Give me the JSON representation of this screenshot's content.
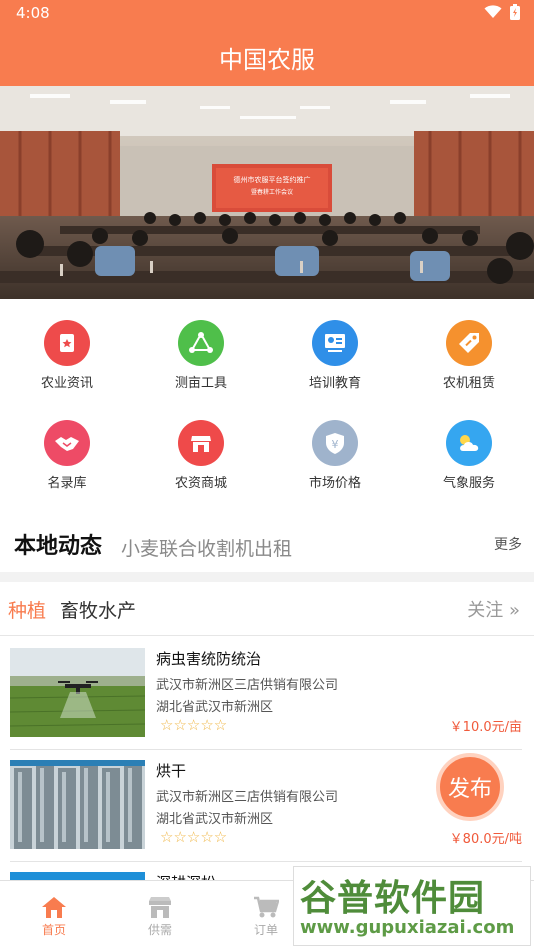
{
  "status": {
    "time": "4:08"
  },
  "header": {
    "title": "中国农服"
  },
  "banner": {
    "screen_line1": "德州市农服平台签约推广",
    "screen_line2": "暨春耕工作会议"
  },
  "grid": [
    {
      "label": "农业资讯",
      "icon": "news-bookmark-icon",
      "color": "#ee4b4b"
    },
    {
      "label": "测亩工具",
      "icon": "measure-tool-icon",
      "color": "#4fbf4a"
    },
    {
      "label": "培训教育",
      "icon": "training-board-icon",
      "color": "#2f8fe8"
    },
    {
      "label": "农机租赁",
      "icon": "rental-tag-icon",
      "color": "#f5912e"
    },
    {
      "label": "名录库",
      "icon": "handshake-icon",
      "color": "#ee4b66"
    },
    {
      "label": "农资商城",
      "icon": "shop-store-icon",
      "color": "#ef4a4a"
    },
    {
      "label": "市场价格",
      "icon": "price-shield-icon",
      "color": "#9fb3cc"
    },
    {
      "label": "气象服务",
      "icon": "weather-icon",
      "color": "#35a6f0"
    }
  ],
  "news": {
    "title": "本地动态",
    "text": "小麦联合收割机出租",
    "more": "更多"
  },
  "tabs": [
    {
      "label": "种植",
      "active": true
    },
    {
      "label": "畜牧水产",
      "active": false
    }
  ],
  "follow": {
    "label": "关注 »"
  },
  "items": [
    {
      "title": "病虫害统防统治",
      "company": "武汉市新洲区三店供销有限公司",
      "address": "湖北省武汉市新洲区",
      "stars": "☆☆☆☆☆",
      "price": "￥10.0元/亩"
    },
    {
      "title": "烘干",
      "company": "武汉市新洲区三店供销有限公司",
      "address": "湖北省武汉市新洲区",
      "stars": "☆☆☆☆☆",
      "price": "￥80.0元/吨"
    },
    {
      "title": "深耕深松",
      "company": "",
      "address": "",
      "stars": "",
      "price": ""
    }
  ],
  "publish": {
    "label": "发布"
  },
  "nav": [
    {
      "label": "首页",
      "icon": "home-icon",
      "active": true
    },
    {
      "label": "供需",
      "icon": "supply-demand-icon",
      "active": false
    },
    {
      "label": "订单",
      "icon": "cart-icon",
      "active": false
    }
  ],
  "watermark": {
    "brand": "谷普软件园",
    "url": "www.gupuxiazai.com"
  },
  "colors": {
    "accent": "#f87c4f",
    "price": "#f05a3b",
    "star": "#f0b84a"
  }
}
